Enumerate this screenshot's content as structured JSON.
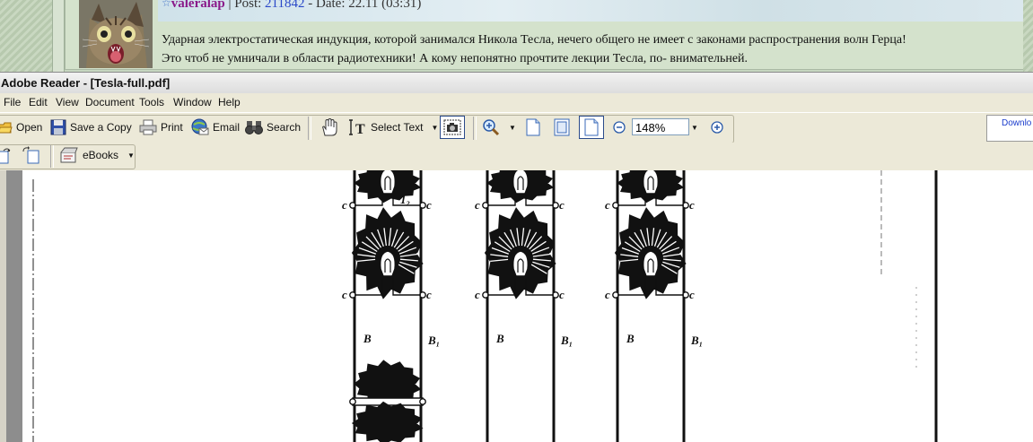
{
  "forum": {
    "username": "valeralap",
    "post_label": "Post:",
    "post_number": "211842",
    "date_label": "Date:",
    "date_value": "22.11 (03:31)",
    "text_line1": "Ударная электростатическая индукция, которой занимался Никола Тесла, нечего общего не имеет с законами распространения волн Герца!",
    "text_line2": "Это чтоб не умничали в области радиотехники! А кому непонятно прочтите лекции Тесла, по- внимательней."
  },
  "window": {
    "title": "Adobe Reader - [Tesla-full.pdf]"
  },
  "menu": [
    "File",
    "Edit",
    "View",
    "Document",
    "Tools",
    "Window",
    "Help"
  ],
  "toolbar": {
    "open": "Open",
    "save_copy": "Save a Copy",
    "print": "Print",
    "email": "Email",
    "search": "Search",
    "select_text": "Select Text",
    "zoom": "148%",
    "download": "Downlo",
    "ebooks": "eBooks"
  },
  "figure": {
    "labels": [
      "1₂",
      "c",
      "B",
      "B₁"
    ]
  },
  "colors": {
    "forum_bg": "#c6d6c0",
    "toolbar_bg": "#ece9d8",
    "username": "#8a1a8a",
    "post_number": "#2a48c8"
  }
}
